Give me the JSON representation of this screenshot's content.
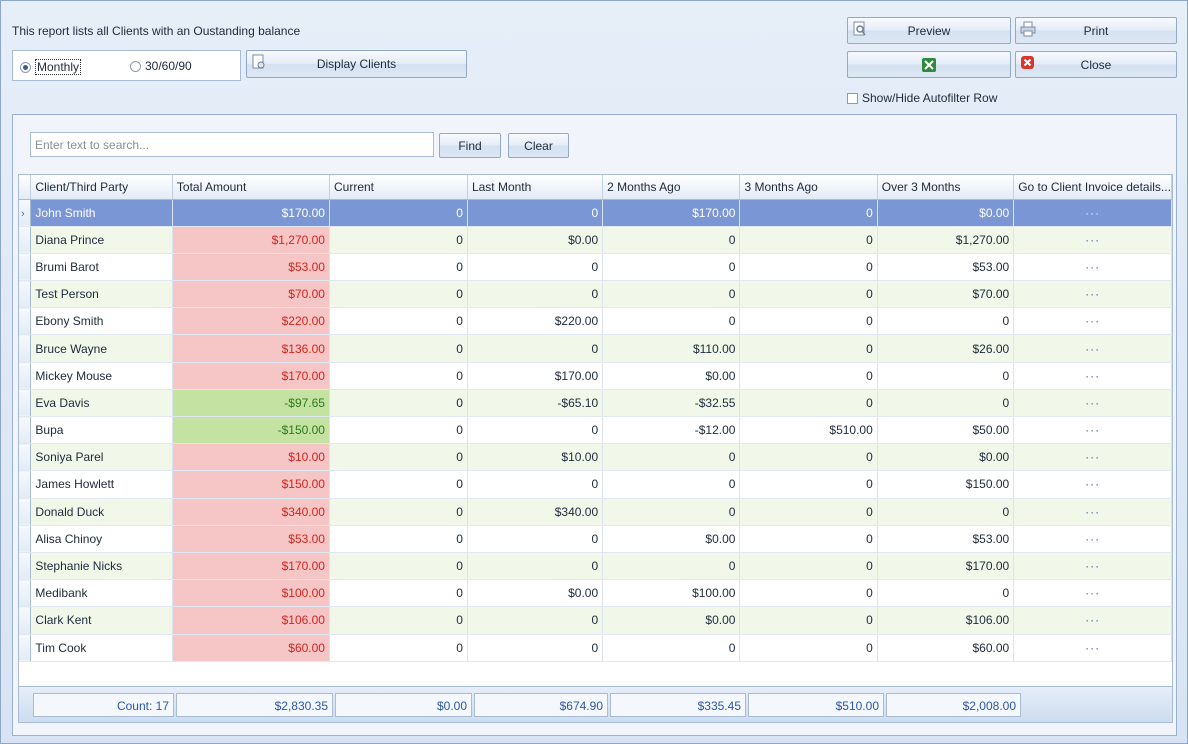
{
  "intro_text": "This report lists all Clients with an Oustanding balance",
  "radios": {
    "monthly": "Monthly",
    "bucket": "30/60/90"
  },
  "buttons": {
    "display_clients": "Display Clients",
    "preview": "Preview",
    "print": "Print",
    "excel": "",
    "close": "Close",
    "find": "Find",
    "clear": "Clear"
  },
  "autofilter_label": "Show/Hide Autofilter Row",
  "search": {
    "placeholder": "Enter text to search..."
  },
  "columns": [
    "Client/Third Party",
    "Total Amount",
    "Current",
    "Last Month",
    "2 Months Ago",
    "3 Months Ago",
    "Over 3 Months",
    "Go to Client Invoice details..."
  ],
  "rows": [
    {
      "name": "John Smith",
      "total": "$170.00",
      "current": "0",
      "last": "0",
      "m2": "$170.00",
      "m3": "0",
      "over": "$0.00",
      "selected": true,
      "sign": "pos"
    },
    {
      "name": "Diana Prince",
      "total": "$1,270.00",
      "current": "0",
      "last": "$0.00",
      "m2": "0",
      "m3": "0",
      "over": "$1,270.00",
      "sign": "pos"
    },
    {
      "name": "Brumi Barot",
      "total": "$53.00",
      "current": "0",
      "last": "0",
      "m2": "0",
      "m3": "0",
      "over": "$53.00",
      "sign": "pos"
    },
    {
      "name": "Test Person",
      "total": "$70.00",
      "current": "0",
      "last": "0",
      "m2": "0",
      "m3": "0",
      "over": "$70.00",
      "sign": "pos"
    },
    {
      "name": "Ebony Smith",
      "total": "$220.00",
      "current": "0",
      "last": "$220.00",
      "m2": "0",
      "m3": "0",
      "over": "0",
      "sign": "pos"
    },
    {
      "name": "Bruce Wayne",
      "total": "$136.00",
      "current": "0",
      "last": "0",
      "m2": "$110.00",
      "m3": "0",
      "over": "$26.00",
      "sign": "pos"
    },
    {
      "name": "Mickey Mouse",
      "total": "$170.00",
      "current": "0",
      "last": "$170.00",
      "m2": "$0.00",
      "m3": "0",
      "over": "0",
      "sign": "pos"
    },
    {
      "name": "Eva Davis",
      "total": "-$97.65",
      "current": "0",
      "last": "-$65.10",
      "m2": "-$32.55",
      "m3": "0",
      "over": "0",
      "sign": "neg"
    },
    {
      "name": "Bupa",
      "total": "-$150.00",
      "current": "0",
      "last": "0",
      "m2": "-$12.00",
      "m3": "$510.00",
      "over": "$50.00",
      "sign": "neg"
    },
    {
      "name": "Soniya Parel",
      "total": "$10.00",
      "current": "0",
      "last": "$10.00",
      "m2": "0",
      "m3": "0",
      "over": "$0.00",
      "sign": "pos"
    },
    {
      "name": "James Howlett",
      "total": "$150.00",
      "current": "0",
      "last": "0",
      "m2": "0",
      "m3": "0",
      "over": "$150.00",
      "sign": "pos"
    },
    {
      "name": "Donald Duck",
      "total": "$340.00",
      "current": "0",
      "last": "$340.00",
      "m2": "0",
      "m3": "0",
      "over": "0",
      "sign": "pos"
    },
    {
      "name": "Alisa Chinoy",
      "total": "$53.00",
      "current": "0",
      "last": "0",
      "m2": "$0.00",
      "m3": "0",
      "over": "$53.00",
      "sign": "pos"
    },
    {
      "name": "Stephanie Nicks",
      "total": "$170.00",
      "current": "0",
      "last": "0",
      "m2": "0",
      "m3": "0",
      "over": "$170.00",
      "sign": "pos"
    },
    {
      "name": "Medibank",
      "total": "$100.00",
      "current": "0",
      "last": "$0.00",
      "m2": "$100.00",
      "m3": "0",
      "over": "0",
      "sign": "pos"
    },
    {
      "name": "Clark Kent",
      "total": "$106.00",
      "current": "0",
      "last": "0",
      "m2": "$0.00",
      "m3": "0",
      "over": "$106.00",
      "sign": "pos"
    },
    {
      "name": "Tim Cook",
      "total": "$60.00",
      "current": "0",
      "last": "0",
      "m2": "0",
      "m3": "0",
      "over": "$60.00",
      "sign": "pos"
    }
  ],
  "row_action_label": "···",
  "totals": {
    "count": "Count: 17",
    "total": "$2,830.35",
    "current": "$0.00",
    "last": "$674.90",
    "m2": "$335.45",
    "m3": "$510.00",
    "over": "$2,008.00"
  },
  "colors": {
    "selected_row": "#7b96d4",
    "positive_total": "#f6c5c5",
    "negative_total": "#c4e2a1"
  }
}
